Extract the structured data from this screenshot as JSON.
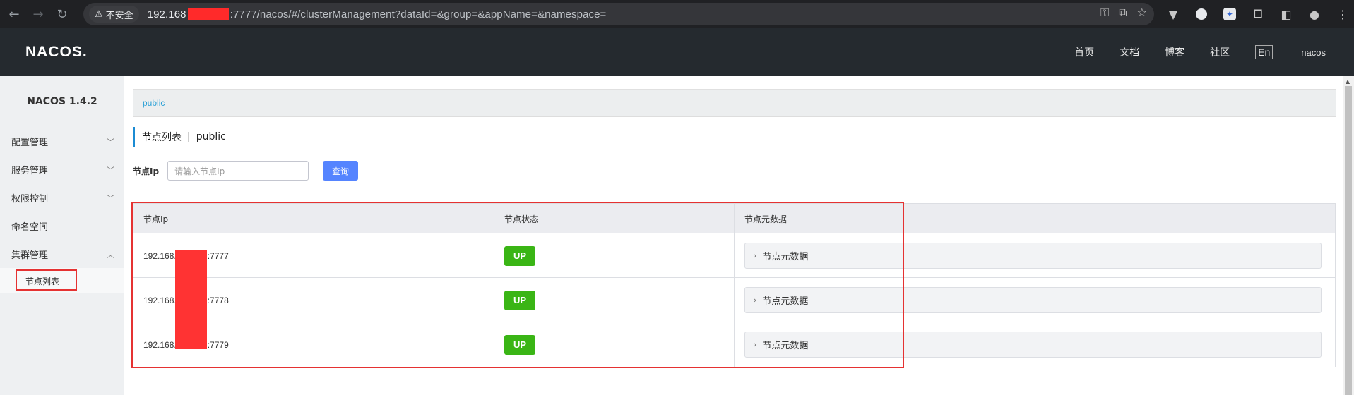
{
  "browser": {
    "insecure_label": "不安全",
    "url_host": "192.168",
    "url_path": ":7777/nacos/#/clusterManagement?dataId=&group=&appName=&namespace="
  },
  "header": {
    "logo": "NACOS.",
    "nav": [
      "首页",
      "文档",
      "博客",
      "社区"
    ],
    "lang": "En",
    "user": "nacos"
  },
  "sidebar": {
    "title": "NACOS 1.4.2",
    "items": [
      {
        "label": "配置管理",
        "arrow": "chevron-down"
      },
      {
        "label": "服务管理",
        "arrow": "chevron-down"
      },
      {
        "label": "权限控制",
        "arrow": "chevron-down"
      },
      {
        "label": "命名空间",
        "arrow": ""
      },
      {
        "label": "集群管理",
        "arrow": "chevron-up"
      }
    ],
    "sub_items": [
      {
        "label": "节点列表"
      }
    ]
  },
  "main": {
    "breadcrumb": "public",
    "title": "节点列表",
    "title_sep": "|",
    "title_ns": "public",
    "search": {
      "label": "节点Ip",
      "placeholder": "请输入节点Ip",
      "button": "查询"
    },
    "table": {
      "headers": [
        "节点Ip",
        "节点状态",
        "节点元数据"
      ],
      "rows": [
        {
          "ip_prefix": "192.168.",
          "ip_suffix": ":7777",
          "status": "UP",
          "meta": "节点元数据"
        },
        {
          "ip_prefix": "192.168.",
          "ip_suffix": ":7778",
          "status": "UP",
          "meta": "节点元数据"
        },
        {
          "ip_prefix": "192.168.",
          "ip_suffix": ":7779",
          "status": "UP",
          "meta": "节点元数据"
        }
      ]
    }
  },
  "colors": {
    "header_bg": "#252a2f",
    "accent": "#5584ff",
    "status_up": "#3ab515",
    "highlight": "#e53232"
  }
}
